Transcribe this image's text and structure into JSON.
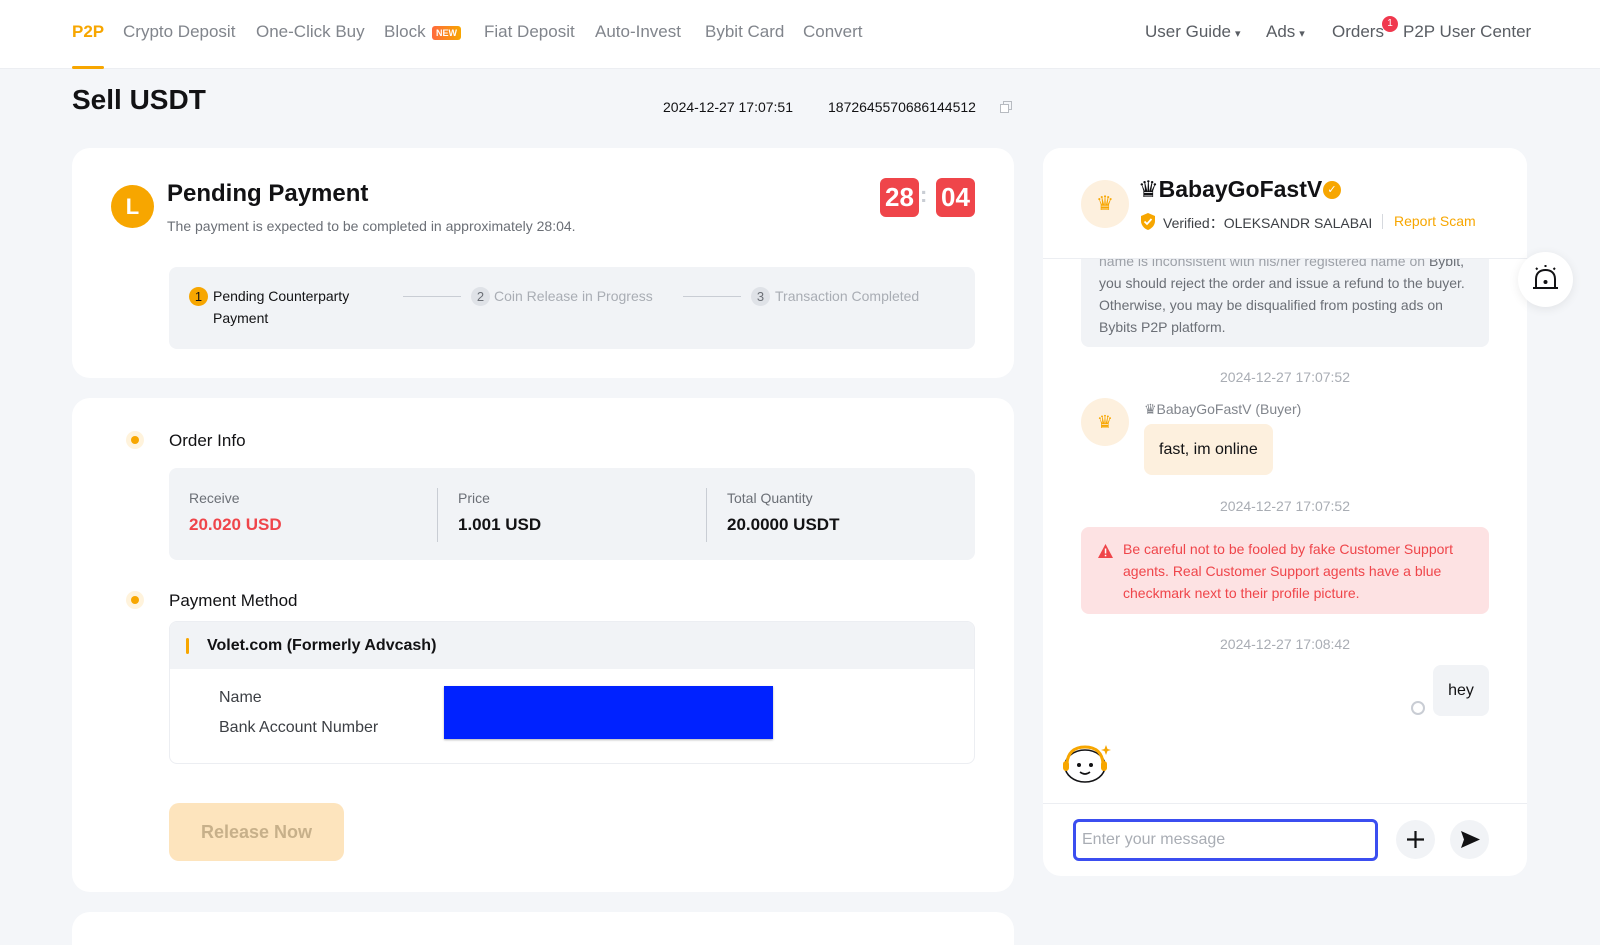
{
  "nav": {
    "items": [
      "P2P",
      "Crypto Deposit",
      "One-Click Buy",
      "Block",
      "Fiat Deposit",
      "Auto-Invest",
      "Bybit Card",
      "Convert"
    ],
    "block_badge": "NEW",
    "right": [
      "User Guide",
      "Ads",
      "Orders",
      "P2P User Center"
    ],
    "orders_count": "1",
    "caret": "▾"
  },
  "order": {
    "title": "Sell USDT",
    "time": "2024-12-27 17:07:51",
    "id": "1872645570686144512"
  },
  "status": {
    "avatar_letter": "L",
    "title": "Pending Payment",
    "subtitle": "The payment is expected to be completed in approximately 28:04.",
    "timer_min": "28",
    "timer_sec": "04",
    "colon": ":",
    "steps": [
      {
        "num": "1",
        "label": "Pending Counterparty Payment"
      },
      {
        "num": "2",
        "label": "Coin Release in Progress"
      },
      {
        "num": "3",
        "label": "Transaction Completed"
      }
    ]
  },
  "order_info": {
    "title": "Order Info",
    "receive_label": "Receive",
    "receive_value": "20.020 USD",
    "price_label": "Price",
    "price_value": "1.001 USD",
    "qty_label": "Total Quantity",
    "qty_value": "20.0000 USDT"
  },
  "payment": {
    "title": "Payment Method",
    "method": "Volet.com (Formerly Advcash)",
    "name_label": "Name",
    "account_label": "Bank Account Number"
  },
  "release_label": "Release Now",
  "chat": {
    "user_name": "♛BabayGoFastV",
    "avatar_glyph": "♛",
    "verified_label": "Verified：OLEKSANDR SALABAI",
    "report_label": "Report Scam",
    "system_message_top": "name is inconsistent with his/her registered name on",
    "system_message_rest": "Bybit, you should reject the order and issue a refund to the buyer. Otherwise, you may be disqualified from posting ads on Bybits P2P platform.",
    "ts1": "2024-12-27 17:07:52",
    "sender": "♛BabayGoFastV (Buyer)",
    "message1": "fast, im online",
    "ts2": "2024-12-27 17:07:52",
    "warning": "Be careful not to be fooled by fake Customer Support agents. Real Customer Support agents have a blue checkmark next to their profile picture.",
    "ts3": "2024-12-27 17:08:42",
    "my_message": "hey",
    "input_placeholder": "Enter your message"
  },
  "colors": {
    "accent": "#f7a600",
    "danger": "#ef454a",
    "focus": "#3b4ef0"
  }
}
